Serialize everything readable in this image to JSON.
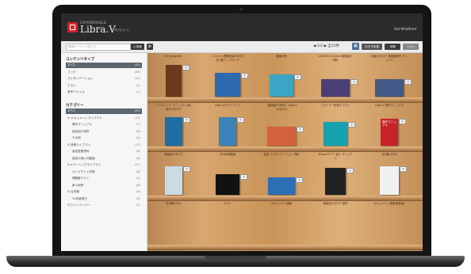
{
  "header": {
    "brand_small": "CHIYODAHOLD",
    "brand": "Libra.V",
    "brand_sub": "デモサイト",
    "user": "Get Whatfront"
  },
  "toolbar": {
    "search_placeholder": "検索キーワードを入力",
    "search_button": "Q 検索",
    "gear": "⚙",
    "pager": "◀ 1/2 ▶ 全15件",
    "sort_button": "おすすめ順",
    "shelf_button": "本棚",
    "list_button": "リスト"
  },
  "sidebar": {
    "content_type_heading": "コンテンツタイプ",
    "content_types": [
      {
        "label": "すべて",
        "count": "(55)",
        "selected": true
      },
      {
        "label": "ブック",
        "count": "(39)"
      },
      {
        "label": "プレゼンテーション",
        "count": "(10)"
      },
      {
        "label": "テスト",
        "count": "(5)"
      },
      {
        "label": "音声ファイル",
        "count": "(1)"
      }
    ],
    "category_heading": "カテゴリー",
    "categories": [
      {
        "label": "すべて",
        "count": "(55)",
        "selected": true
      },
      {
        "label": "⊖ ドキュメントライブラリ",
        "count": "(17)"
      },
      {
        "label": "操作マニュアル",
        "count": "(7)",
        "indent": true
      },
      {
        "label": "製品紹介資料",
        "count": "(6)",
        "indent": true
      },
      {
        "label": "その他",
        "count": "(4)",
        "indent": true
      },
      {
        "label": "⊖ 営業ライブラリ",
        "count": "(17)"
      },
      {
        "label": "製品営業資料",
        "count": "(8)",
        "indent": true
      },
      {
        "label": "製品の使い方動画",
        "count": "(9)",
        "indent": true
      },
      {
        "label": "⊖ eラーニングライブラリ",
        "count": "(21)"
      },
      {
        "label": "オンデマンド学習",
        "count": "(8)",
        "indent": true
      },
      {
        "label": "理解度テスト",
        "count": "(5)",
        "indent": true
      },
      {
        "label": "新人研修",
        "count": "(8)",
        "indent": true
      },
      {
        "label": "⊖ 社内報",
        "count": "(6)"
      },
      {
        "label": "10年度発行",
        "count": "(6)",
        "indent": true
      },
      {
        "label": "ホワイトペーパー",
        "count": "(5)"
      }
    ]
  },
  "shelf": {
    "rows": [
      {
        "labels": [
          "ID_sample01",
          "リスキャン業務改善の手引き ゼロ版アップロード",
          "動画の例",
          "LOGISTICS Libra.V製品紹介 資料",
          "製品カタログ 英語版操作 マニュアル"
        ]
      },
      {
        "labels": [
          "パンフレット マニュアル (仮)操作の手引き",
          "Libra_Vガイドブック",
          "【製品紹介資料】 Libra.V 2016/10",
          "スライド一覧表示 テスト",
          "Libra.V 操作マニュアル"
        ]
      },
      {
        "labels": [
          "新製品カタログ",
          "VR360度動画",
          "製品 プレゼンテーション 資料",
          "iPhoneアプリ 紹介 マニュアル",
          "社内報 2016"
        ]
      },
      {
        "labels": [
          "社内報 2015",
          "テスト",
          "セキュリティ講座",
          "新製品カタログ 案内",
          "セキュリティ講座(更新版)"
        ]
      }
    ],
    "books": [
      {
        "title": "",
        "color": "#6b3a1c"
      },
      {
        "title": "",
        "color": "#2e6ab0"
      },
      {
        "title": "",
        "color": "#3aa5c4"
      },
      {
        "title": "",
        "color": "#4b3f75"
      },
      {
        "title": "",
        "color": "#445a86"
      },
      {
        "title": "",
        "color": "#1f6ea6"
      },
      {
        "title": "",
        "color": "#3b82b8"
      },
      {
        "title": "",
        "color": "#d4613c"
      },
      {
        "title": "",
        "color": "#17a2b0"
      },
      {
        "title": "操作マニュアル",
        "color": "#c8232a"
      },
      {
        "title": "",
        "color": "#c9dbe4"
      },
      {
        "title": "",
        "color": "#111111"
      },
      {
        "title": "",
        "color": "#2d6fb5"
      },
      {
        "title": "",
        "color": "#222222"
      },
      {
        "title": "",
        "color": "#f0f0f0"
      }
    ]
  }
}
